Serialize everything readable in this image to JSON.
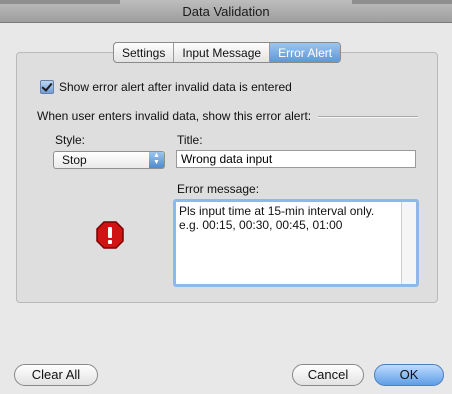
{
  "window": {
    "title": "Data Validation"
  },
  "tabs": [
    {
      "label": "Settings",
      "active": false
    },
    {
      "label": "Input Message",
      "active": false
    },
    {
      "label": "Error Alert",
      "active": true
    }
  ],
  "error_alert": {
    "show_checkbox": {
      "label": "Show error alert after invalid data is entered",
      "checked": true
    },
    "section_label": "When user enters invalid data, show this error alert:",
    "style": {
      "label": "Style:",
      "value": "Stop"
    },
    "title": {
      "label": "Title:",
      "value": "Wrong data input"
    },
    "message": {
      "label": "Error message:",
      "value": "Pls input time at 15-min interval only.\ne.g. 00:15, 00:30, 00:45, 01:00"
    },
    "icon": "stop-icon"
  },
  "buttons": {
    "clear_all": "Clear All",
    "cancel": "Cancel",
    "ok": "OK"
  },
  "colors": {
    "accent": "#5f97d8",
    "stop_red": "#d01414"
  }
}
